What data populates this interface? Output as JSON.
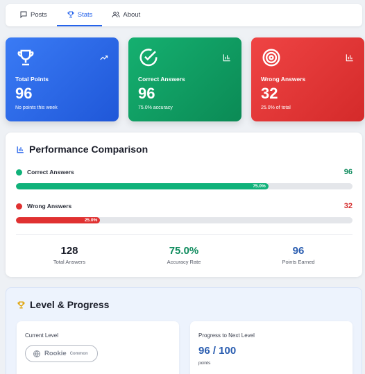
{
  "tabs": [
    {
      "label": "Posts",
      "icon": "chat-bubble-icon",
      "active": false
    },
    {
      "label": "Stats",
      "icon": "trophy-icon",
      "active": true
    },
    {
      "label": "About",
      "icon": "users-icon",
      "active": false
    }
  ],
  "stats": [
    {
      "label": "Total Points",
      "value": "96",
      "sub": "No points this week",
      "color": "#2563eb",
      "icon": "trophy-icon",
      "corner_icon": "trending-up-icon"
    },
    {
      "label": "Correct Answers",
      "value": "96",
      "sub": "75.0% accuracy",
      "color": "#10a062",
      "icon": "check-circle-icon",
      "corner_icon": "bar-chart-icon"
    },
    {
      "label": "Wrong Answers",
      "value": "32",
      "sub": "25.0% of total",
      "color": "#e03131",
      "icon": "target-icon",
      "corner_icon": "bar-chart-icon"
    }
  ],
  "performance": {
    "title": "Performance Comparison",
    "rows": [
      {
        "label": "Correct Answers",
        "value": "96",
        "percent_label": "75.0%",
        "fraction": 0.75,
        "color": "#10b27a",
        "value_color": "#0e8b5d"
      },
      {
        "label": "Wrong Answers",
        "value": "32",
        "percent_label": "25.0%",
        "fraction": 0.25,
        "color": "#e03131",
        "value_color": "#d42b2b"
      }
    ],
    "summary": [
      {
        "value": "128",
        "caption": "Total Answers",
        "color": "#1a1d29"
      },
      {
        "value": "75.0%",
        "caption": "Accuracy Rate",
        "color": "#0e8b5d"
      },
      {
        "value": "96",
        "caption": "Points Earned",
        "color": "#2a5db0"
      }
    ]
  },
  "level": {
    "title": "Level & Progress",
    "current_level": {
      "title": "Current Level",
      "name": "Rookie",
      "rarity": "Common"
    },
    "progress": {
      "title": "Progress to Next Level",
      "value": "96 / 100",
      "unit": "points"
    }
  }
}
